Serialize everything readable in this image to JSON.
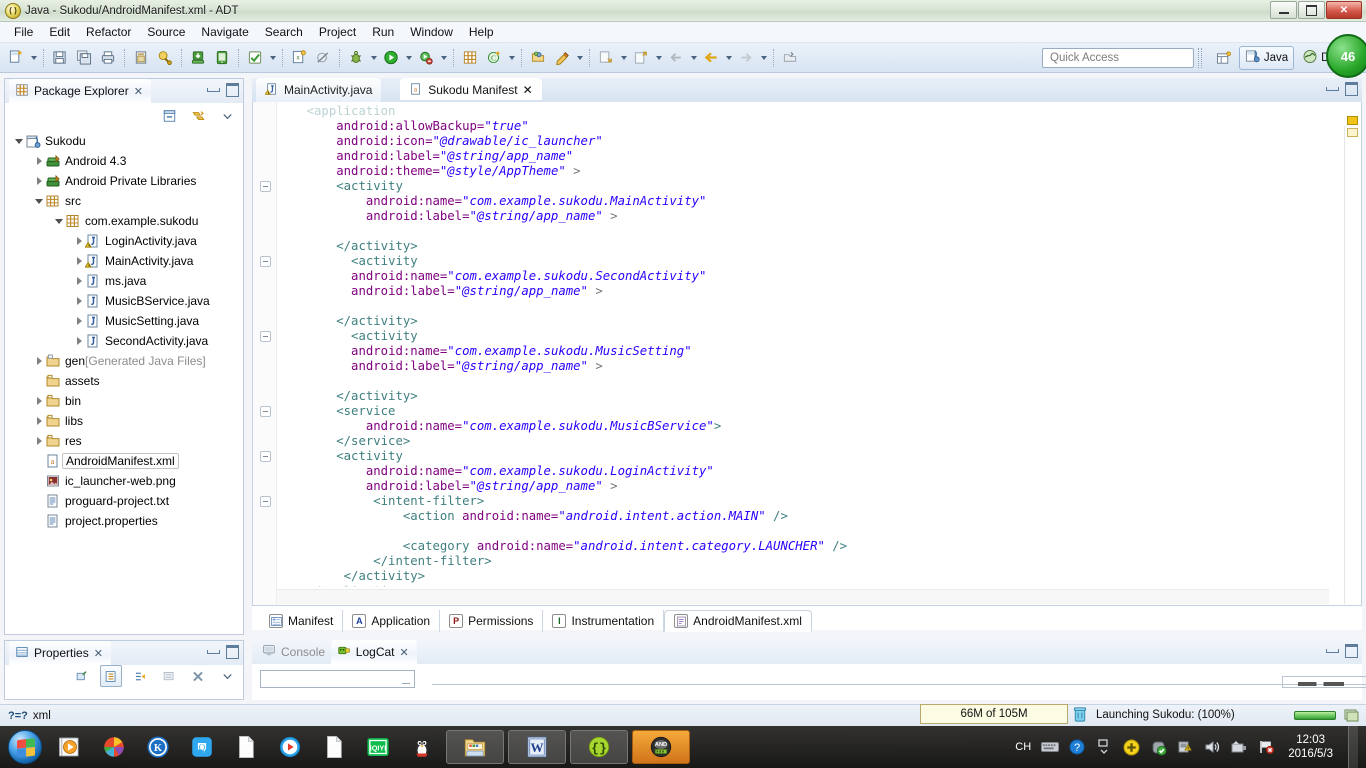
{
  "window": {
    "title": "Java - Sukodu/AndroidManifest.xml - ADT",
    "app_icon": "adt-icon",
    "controls": {
      "minimize": "minimize-icon",
      "maximize": "maximize-icon",
      "close": "close-icon"
    }
  },
  "menubar": {
    "items": [
      "File",
      "Edit",
      "Refactor",
      "Source",
      "Navigate",
      "Search",
      "Project",
      "Run",
      "Window",
      "Help"
    ]
  },
  "toolbar": {
    "quick_access_placeholder": "Quick Access",
    "perspectives": [
      {
        "label": "Java",
        "icon": "java-perspective-icon",
        "active": true
      },
      {
        "label": "DDMS",
        "icon": "ddms-perspective-icon",
        "active": false
      }
    ],
    "open_perspective_icon": "open-perspective-icon",
    "update_badge": "46",
    "buttons": [
      "new-wizard",
      "new-wizard-dropdown",
      "save",
      "save-all",
      "print",
      "export-android-app",
      "sign-export-wizard",
      "android-sdk-manager",
      "android-virtual-device-manager",
      "toggle-mark-occurrences",
      "mark-occurrences-dropdown",
      "new-android-xml-file",
      "skip-breakpoints",
      "debug",
      "debug-dropdown",
      "run",
      "run-dropdown",
      "run-external-tools",
      "external-tools-dropdown",
      "new-java-package",
      "new-java-class",
      "new-class-dropdown",
      "open-type",
      "search",
      "search-dropdown",
      "next-annotation",
      "next-annotation-dropdown",
      "previous-annotation",
      "previous-annotation-dropdown",
      "back",
      "back-dropdown",
      "forward",
      "forward-dropdown",
      "open-task"
    ]
  },
  "package_explorer": {
    "title": "Package Explorer",
    "close_icon": "close-icon",
    "view_icons": [
      "collapse-all-icon",
      "link-with-editor-icon",
      "view-menu-icon"
    ],
    "min_icon": "minimize-icon",
    "max_icon": "maximize-icon",
    "tree": [
      {
        "label": "Sukodu",
        "indent": 0,
        "arrow": "open",
        "icon": "java-project-icon"
      },
      {
        "label": "Android 4.3",
        "indent": 1,
        "arrow": "closed",
        "icon": "android-library-icon"
      },
      {
        "label": "Android Private Libraries",
        "indent": 1,
        "arrow": "closed",
        "icon": "android-library-icon"
      },
      {
        "label": "src",
        "indent": 1,
        "arrow": "open",
        "icon": "source-folder-icon"
      },
      {
        "label": "com.example.sukodu",
        "indent": 2,
        "arrow": "open",
        "icon": "package-icon"
      },
      {
        "label": "LoginActivity.java",
        "indent": 3,
        "arrow": "closed",
        "icon": "java-file-warning-icon"
      },
      {
        "label": "MainActivity.java",
        "indent": 3,
        "arrow": "closed",
        "icon": "java-file-warning-icon"
      },
      {
        "label": "ms.java",
        "indent": 3,
        "arrow": "closed",
        "icon": "java-file-icon"
      },
      {
        "label": "MusicBService.java",
        "indent": 3,
        "arrow": "closed",
        "icon": "java-file-icon"
      },
      {
        "label": "MusicSetting.java",
        "indent": 3,
        "arrow": "closed",
        "icon": "java-file-icon"
      },
      {
        "label": "SecondActivity.java",
        "indent": 3,
        "arrow": "closed",
        "icon": "java-file-icon"
      },
      {
        "label": "gen",
        "suffix": " [Generated Java Files]",
        "indent": 1,
        "arrow": "closed",
        "icon": "gen-folder-icon"
      },
      {
        "label": "assets",
        "indent": 1,
        "arrow": "none",
        "icon": "folder-icon"
      },
      {
        "label": "bin",
        "indent": 1,
        "arrow": "closed",
        "icon": "folder-icon"
      },
      {
        "label": "libs",
        "indent": 1,
        "arrow": "closed",
        "icon": "folder-icon"
      },
      {
        "label": "res",
        "indent": 1,
        "arrow": "closed",
        "icon": "folder-icon"
      },
      {
        "label": "AndroidManifest.xml",
        "indent": 1,
        "arrow": "none",
        "icon": "android-manifest-icon",
        "selected": true
      },
      {
        "label": "ic_launcher-web.png",
        "indent": 1,
        "arrow": "none",
        "icon": "image-file-icon"
      },
      {
        "label": "proguard-project.txt",
        "indent": 1,
        "arrow": "none",
        "icon": "text-file-icon"
      },
      {
        "label": "project.properties",
        "indent": 1,
        "arrow": "none",
        "icon": "text-file-icon"
      }
    ]
  },
  "editor": {
    "tabs": [
      {
        "label": "MainActivity.java",
        "icon": "java-file-warning-icon",
        "active": false,
        "closeable": false
      },
      {
        "label": "Sukodu Manifest",
        "icon": "android-manifest-icon",
        "active": true,
        "closeable": true,
        "close_icon": "close-icon"
      }
    ],
    "min_icon": "minimize-icon",
    "max_icon": "maximize-icon",
    "code_lines": [
      {
        "indent": 4,
        "segments": [
          {
            "t": "<application",
            "c": "kw"
          }
        ],
        "clipped": true
      },
      {
        "indent": 8,
        "segments": [
          {
            "t": "android:allowBackup=",
            "c": "at"
          },
          {
            "t": "\"true\"",
            "c": "val"
          }
        ]
      },
      {
        "indent": 8,
        "segments": [
          {
            "t": "android:icon=",
            "c": "at"
          },
          {
            "t": "\"@drawable/ic_launcher\"",
            "c": "val"
          }
        ]
      },
      {
        "indent": 8,
        "segments": [
          {
            "t": "android:label=",
            "c": "at"
          },
          {
            "t": "\"@string/app_name\"",
            "c": "val"
          }
        ]
      },
      {
        "indent": 8,
        "segments": [
          {
            "t": "android:theme=",
            "c": "at"
          },
          {
            "t": "\"@style/AppTheme\"",
            "c": "val"
          },
          {
            "t": " >",
            "c": "pun"
          }
        ]
      },
      {
        "indent": 8,
        "segments": [
          {
            "t": "<activity",
            "c": "kw"
          }
        ],
        "fold": true
      },
      {
        "indent": 12,
        "segments": [
          {
            "t": "android:name=",
            "c": "at"
          },
          {
            "t": "\"com.example.sukodu.MainActivity\"",
            "c": "val"
          }
        ]
      },
      {
        "indent": 12,
        "segments": [
          {
            "t": "android:label=",
            "c": "at"
          },
          {
            "t": "\"@string/app_name\"",
            "c": "val"
          },
          {
            "t": " >",
            "c": "pun"
          }
        ]
      },
      {
        "indent": 0,
        "segments": []
      },
      {
        "indent": 8,
        "segments": [
          {
            "t": "</activity>",
            "c": "kw"
          }
        ]
      },
      {
        "indent": 10,
        "segments": [
          {
            "t": "<activity",
            "c": "kw"
          }
        ],
        "fold": true
      },
      {
        "indent": 10,
        "segments": [
          {
            "t": "android:name=",
            "c": "at"
          },
          {
            "t": "\"com.example.sukodu.SecondActivity\"",
            "c": "val"
          }
        ]
      },
      {
        "indent": 10,
        "segments": [
          {
            "t": "android:label=",
            "c": "at"
          },
          {
            "t": "\"@string/app_name\"",
            "c": "val"
          },
          {
            "t": " >",
            "c": "pun"
          }
        ]
      },
      {
        "indent": 0,
        "segments": []
      },
      {
        "indent": 8,
        "segments": [
          {
            "t": "</activity>",
            "c": "kw"
          }
        ]
      },
      {
        "indent": 10,
        "segments": [
          {
            "t": "<activity",
            "c": "kw"
          }
        ],
        "fold": true
      },
      {
        "indent": 10,
        "segments": [
          {
            "t": "android:name=",
            "c": "at"
          },
          {
            "t": "\"com.example.sukodu.MusicSetting\"",
            "c": "val"
          }
        ]
      },
      {
        "indent": 10,
        "segments": [
          {
            "t": "android:label=",
            "c": "at"
          },
          {
            "t": "\"@string/app_name\"",
            "c": "val"
          },
          {
            "t": " >",
            "c": "pun"
          }
        ]
      },
      {
        "indent": 0,
        "segments": []
      },
      {
        "indent": 8,
        "segments": [
          {
            "t": "</activity>",
            "c": "kw"
          }
        ]
      },
      {
        "indent": 8,
        "segments": [
          {
            "t": "<service",
            "c": "kw"
          }
        ],
        "fold": true
      },
      {
        "indent": 12,
        "segments": [
          {
            "t": "android:name=",
            "c": "at"
          },
          {
            "t": "\"com.example.sukodu.MusicBService\"",
            "c": "val"
          },
          {
            "t": ">",
            "c": "kw"
          }
        ]
      },
      {
        "indent": 8,
        "segments": [
          {
            "t": "</service>",
            "c": "kw"
          }
        ]
      },
      {
        "indent": 8,
        "segments": [
          {
            "t": "<activity",
            "c": "kw"
          }
        ],
        "fold": true
      },
      {
        "indent": 12,
        "segments": [
          {
            "t": "android:name=",
            "c": "at"
          },
          {
            "t": "\"com.example.sukodu.LoginActivity\"",
            "c": "val"
          }
        ]
      },
      {
        "indent": 12,
        "segments": [
          {
            "t": "android:label=",
            "c": "at"
          },
          {
            "t": "\"@string/app_name\"",
            "c": "val"
          },
          {
            "t": " >",
            "c": "pun"
          }
        ]
      },
      {
        "indent": 13,
        "segments": [
          {
            "t": "<intent-filter>",
            "c": "kw"
          }
        ],
        "fold": true
      },
      {
        "indent": 17,
        "segments": [
          {
            "t": "<action ",
            "c": "kw"
          },
          {
            "t": "android:name=",
            "c": "at"
          },
          {
            "t": "\"android.intent.action.MAIN\"",
            "c": "val"
          },
          {
            "t": " />",
            "c": "kw"
          }
        ]
      },
      {
        "indent": 0,
        "segments": []
      },
      {
        "indent": 17,
        "segments": [
          {
            "t": "<category ",
            "c": "kw"
          },
          {
            "t": "android:name=",
            "c": "at"
          },
          {
            "t": "\"android.intent.category.LAUNCHER\"",
            "c": "val"
          },
          {
            "t": " />",
            "c": "kw"
          }
        ]
      },
      {
        "indent": 13,
        "segments": [
          {
            "t": "</intent-filter>",
            "c": "kw"
          }
        ]
      },
      {
        "indent": 9,
        "segments": [
          {
            "t": "</activity>",
            "c": "kw"
          }
        ]
      },
      {
        "indent": 4,
        "segments": [
          {
            "t": "</application>",
            "c": "kw"
          }
        ],
        "clipped": true
      }
    ],
    "page_tabs": [
      {
        "label": "Manifest",
        "badge": "M",
        "icon": "manifest-form-icon",
        "selected": false
      },
      {
        "label": "Application",
        "badge": "A",
        "icon": "application-icon",
        "selected": false
      },
      {
        "label": "Permissions",
        "badge": "P",
        "icon": "permissions-icon",
        "selected": false
      },
      {
        "label": "Instrumentation",
        "badge": "I",
        "icon": "instrumentation-icon",
        "selected": false
      },
      {
        "label": "AndroidManifest.xml",
        "badge": "",
        "icon": "xml-source-icon",
        "selected": true
      }
    ]
  },
  "properties_view": {
    "title": "Properties",
    "close_icon": "close-icon",
    "toolbar_icons": [
      "show-advanced-icon",
      "show-categories-icon",
      "restore-default-icon",
      "pin-icon",
      "close-view-icon",
      "view-menu-icon"
    ],
    "min_icon": "minimize-icon",
    "max_icon": "maximize-icon"
  },
  "console_view": {
    "tabs": [
      {
        "label": "Console",
        "icon": "console-icon",
        "active": false
      },
      {
        "label": "LogCat",
        "icon": "logcat-icon",
        "active": true,
        "close_icon": "close-icon"
      }
    ],
    "filter_value": "",
    "search_value": "",
    "min_icon": "minimize-icon",
    "max_icon": "maximize-icon"
  },
  "statusbar": {
    "editor_type": "xml",
    "editor_type_icon": "xml-declaration-icon",
    "heap_status": "66M of 105M",
    "trash_icon": "garbage-collect-icon",
    "task_text": "Launching Sukodu: (100%)",
    "progress_icon": "progress-bar",
    "progress_detail_icon": "show-progress-icon"
  },
  "taskbar": {
    "start_icon": "windows-start-orb",
    "pinned": [
      {
        "name": "media-player-icon"
      },
      {
        "name": "colorful-ball-icon"
      },
      {
        "name": "kingsoft-icon"
      },
      {
        "name": "qq-browser-icon"
      },
      {
        "name": "blank-document-icon"
      },
      {
        "name": "media-player-classic-icon"
      },
      {
        "name": "blank-document-2-icon"
      },
      {
        "name": "iqiyi-icon"
      },
      {
        "name": "qq-penguin-icon"
      }
    ],
    "windows": [
      {
        "name": "file-explorer-window"
      },
      {
        "name": "word-document-window"
      },
      {
        "name": "notepadpp-window"
      },
      {
        "name": "android-adt-window",
        "active": true
      }
    ],
    "tray": [
      {
        "name": "ime-indicator",
        "label": "CH"
      },
      {
        "name": "keyboard-icon"
      },
      {
        "name": "help-icon"
      },
      {
        "name": "show-hidden-icons-icon"
      },
      {
        "name": "security-shield-icon"
      },
      {
        "name": "antivirus-icon"
      },
      {
        "name": "network-alert-icon"
      },
      {
        "name": "volume-icon"
      },
      {
        "name": "usb-eject-icon"
      },
      {
        "name": "action-center-flag-icon"
      }
    ],
    "clock": {
      "time": "12:03",
      "date": "2016/5/3"
    },
    "show_desktop": "show-desktop-button"
  }
}
